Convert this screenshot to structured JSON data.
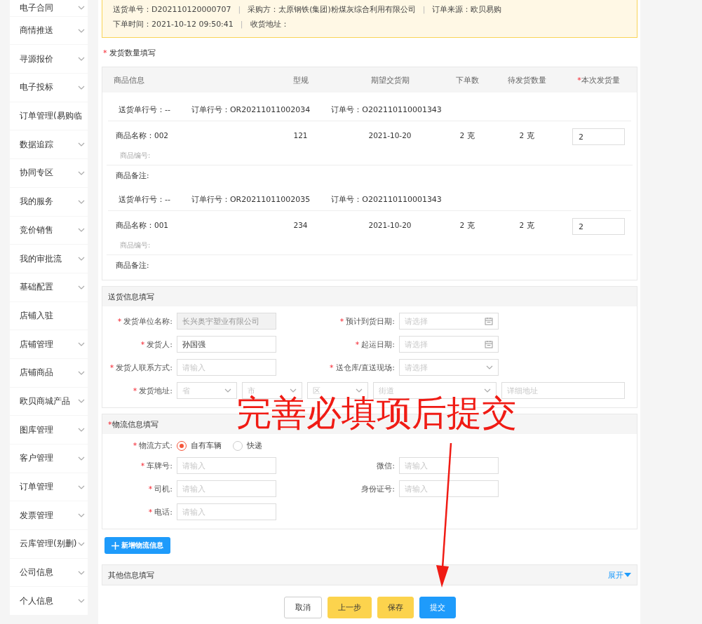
{
  "sidebar": {
    "items": [
      {
        "label": "电子合同",
        "expandable": true
      },
      {
        "label": "商情推送",
        "expandable": true
      },
      {
        "label": "寻源报价",
        "expandable": true
      },
      {
        "label": "电子投标",
        "expandable": true
      },
      {
        "label": "订单管理(易购临",
        "expandable": false
      },
      {
        "label": "数据追踪",
        "expandable": true
      },
      {
        "label": "协同专区",
        "expandable": true
      },
      {
        "label": "我的服务",
        "expandable": true
      },
      {
        "label": "竞价销售",
        "expandable": true
      },
      {
        "label": "我的审批流",
        "expandable": true
      },
      {
        "label": "基础配置",
        "expandable": true
      },
      {
        "label": "店铺入驻",
        "expandable": false
      },
      {
        "label": "店铺管理",
        "expandable": true
      },
      {
        "label": "店铺商品",
        "expandable": true
      },
      {
        "label": "欧贝商城产品",
        "expandable": true
      },
      {
        "label": "图库管理",
        "expandable": true
      },
      {
        "label": "客户管理",
        "expandable": true
      },
      {
        "label": "订单管理",
        "expandable": true
      },
      {
        "label": "发票管理",
        "expandable": true
      },
      {
        "label": "云库管理(别删)",
        "expandable": true
      },
      {
        "label": "公司信息",
        "expandable": true
      },
      {
        "label": "个人信息",
        "expandable": true
      }
    ]
  },
  "banner": {
    "separator": "|",
    "rows": [
      [
        "送货单号：D202110120000707",
        "采购方：太原钢铁(集团)粉煤灰综合利用有限公司",
        "订单来源：欧贝易购"
      ],
      [
        "下单时间：2021-10-12 09:50:41",
        "收货地址："
      ]
    ]
  },
  "quantity_section": {
    "mark": "*",
    "title": "发货数量填写",
    "columns": [
      {
        "label": "商品信息"
      },
      {
        "label": "型规"
      },
      {
        "label": "期望交货期"
      },
      {
        "label": "下单数"
      },
      {
        "label": "待发货数量"
      },
      {
        "mark": "*",
        "label": "本次发货量"
      }
    ],
    "groups": [
      {
        "meta": [
          "送货单行号：--",
          "订单行号：OR20211011002034",
          "订单号：O202110110001343"
        ],
        "name": "商品名称：002",
        "spec": "121",
        "date": "2021-10-20",
        "ordered": "2 克",
        "pending": "2 克",
        "quantity": "2",
        "code": "商品编号:",
        "remark": "商品备注:"
      },
      {
        "meta": [
          "送货单行号：--",
          "订单行号：OR20211011002035",
          "订单号：O202110110001343"
        ],
        "name": "商品名称：001",
        "spec": "234",
        "date": "2021-10-20",
        "ordered": "2 克",
        "pending": "2 克",
        "quantity": "2",
        "code": "商品编号:",
        "remark": "商品备注:"
      }
    ]
  },
  "delivery_section": {
    "title": "送货信息填写",
    "rows": [
      {
        "kind": "pair",
        "fields": [
          {
            "mark": "*",
            "label": "发货单位名称:",
            "kind": "input",
            "value": "长兴奥宇塑业有限公司",
            "disabled": true
          },
          {
            "mark": "*",
            "label": "预计到货日期:",
            "kind": "date",
            "placeholder": "请选择",
            "disabled": false
          }
        ]
      },
      {
        "kind": "pair",
        "fields": [
          {
            "mark": "*",
            "label": "发货人:",
            "kind": "input",
            "value": "孙国强",
            "disabled": false
          },
          {
            "mark": "*",
            "label": "起运日期:",
            "kind": "date",
            "placeholder": "请选择",
            "disabled": false
          }
        ]
      },
      {
        "kind": "pair",
        "fields": [
          {
            "mark": "*",
            "label": "发货人联系方式:",
            "kind": "input",
            "placeholder": "请输入",
            "disabled": false
          },
          {
            "mark": "*",
            "label": "送仓库/直送现场:",
            "kind": "select",
            "placeholder": "请选择",
            "disabled": false
          }
        ]
      },
      {
        "kind": "address",
        "mark": "*",
        "label": "发货地址:",
        "controls": [
          {
            "kind": "select",
            "placeholder": "省"
          },
          {
            "kind": "select",
            "placeholder": "市"
          },
          {
            "kind": "select",
            "placeholder": "区"
          },
          {
            "kind": "select",
            "placeholder": "街道"
          },
          {
            "kind": "input",
            "placeholder": "详细地址"
          }
        ]
      }
    ]
  },
  "logistics_section": {
    "mark": "*",
    "title": "物流信息填写",
    "method": {
      "mark": "*",
      "label": "物流方式:",
      "options": [
        {
          "label": "自有车辆",
          "selected": true
        },
        {
          "label": "快递",
          "selected": false
        }
      ]
    },
    "rows": [
      {
        "kind": "pair",
        "fields": [
          {
            "mark": "*",
            "label": "车牌号:",
            "kind": "input",
            "placeholder": "请输入",
            "disabled": false
          },
          {
            "label": "微信:",
            "kind": "input",
            "placeholder": "请输入",
            "disabled": false
          }
        ]
      },
      {
        "kind": "pair",
        "fields": [
          {
            "mark": "*",
            "label": "司机:",
            "kind": "input",
            "placeholder": "请输入",
            "disabled": false
          },
          {
            "label": "身份证号:",
            "kind": "input",
            "placeholder": "请输入",
            "disabled": false
          }
        ]
      },
      {
        "kind": "pair",
        "fields": [
          {
            "mark": "*",
            "label": "电话:",
            "kind": "input",
            "placeholder": "请输入",
            "disabled": false
          }
        ]
      }
    ]
  },
  "add_logistics_button": "新增物流信息",
  "other_section": {
    "title": "其他信息填写",
    "toggle": "展开"
  },
  "actions": [
    {
      "label": "取消",
      "kind": "default"
    },
    {
      "label": "上一步",
      "kind": "warning"
    },
    {
      "label": "保存",
      "kind": "warning"
    },
    {
      "label": "提交",
      "kind": "primary"
    }
  ],
  "annotation": {
    "text": "完善必填项后提交"
  }
}
